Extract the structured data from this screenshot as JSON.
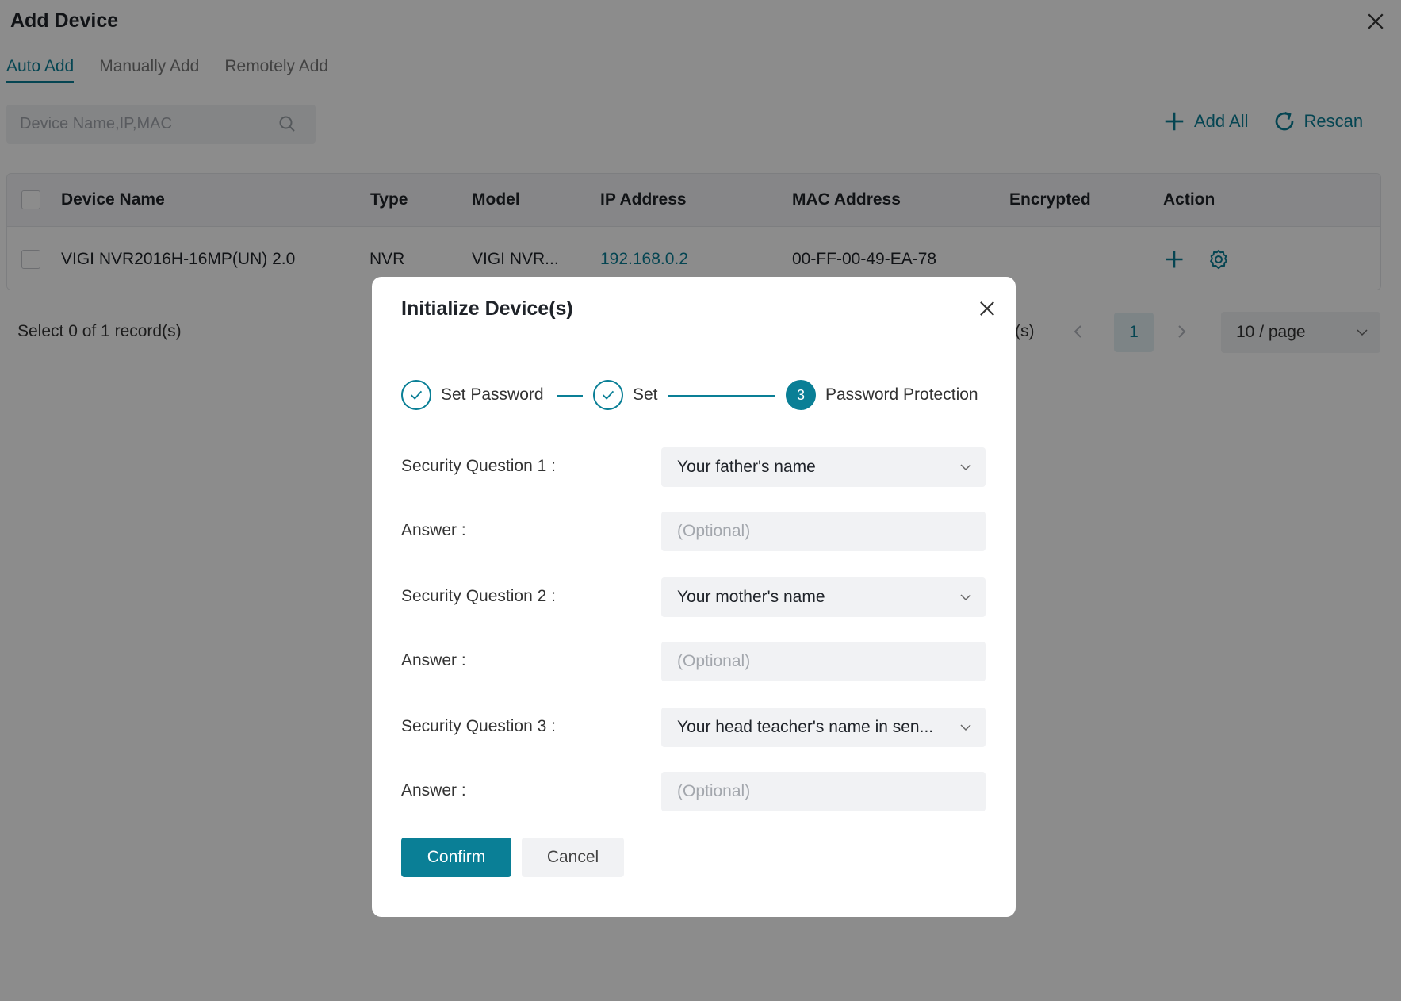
{
  "header": {
    "title": "Add Device"
  },
  "tabs": [
    {
      "label": "Auto Add",
      "active": true
    },
    {
      "label": "Manually Add",
      "active": false
    },
    {
      "label": "Remotely Add",
      "active": false
    }
  ],
  "search": {
    "placeholder": "Device Name,IP,MAC"
  },
  "toolbar": {
    "add_all_label": "Add All",
    "rescan_label": "Rescan"
  },
  "table": {
    "columns": [
      "Device Name",
      "Type",
      "Model",
      "IP Address",
      "MAC Address",
      "Encrypted",
      "Action"
    ],
    "rows": [
      {
        "device_name": "VIGI NVR2016H-16MP(UN) 2.0",
        "type": "NVR",
        "model": "VIGI NVR...",
        "ip": "192.168.0.2",
        "mac": "00-FF-00-49-EA-78",
        "encrypted": ""
      }
    ]
  },
  "pagination": {
    "records_text": "Select 0 of 1 record(s)",
    "partial_text": "(s)",
    "current_page": "1",
    "page_size": "10 / page"
  },
  "modal": {
    "title": "Initialize Device(s)",
    "steps": [
      {
        "label": "Set Password",
        "state": "done"
      },
      {
        "label": "Set",
        "state": "done"
      },
      {
        "label": "Password Protection",
        "state": "active",
        "number": "3"
      }
    ],
    "fields": [
      {
        "label": "Security Question 1 :",
        "value": "Your father's name"
      },
      {
        "label": "Answer :",
        "placeholder": "(Optional)"
      },
      {
        "label": "Security Question 2 :",
        "value": "Your mother's name"
      },
      {
        "label": "Answer :",
        "placeholder": "(Optional)"
      },
      {
        "label": "Security Question 3 :",
        "value": "Your head teacher's name in sen..."
      },
      {
        "label": "Answer :",
        "placeholder": "(Optional)"
      }
    ],
    "confirm_label": "Confirm",
    "cancel_label": "Cancel"
  },
  "colors": {
    "accent": "#0a7f96",
    "overlay": "rgba(0,0,0,0.45)",
    "field_bg": "#f1f2f4"
  },
  "icons": [
    "close-icon",
    "search-icon",
    "plus-icon",
    "refresh-icon",
    "gear-icon",
    "check-icon",
    "chevron-down-icon",
    "chevron-left-icon",
    "chevron-right-icon"
  ]
}
